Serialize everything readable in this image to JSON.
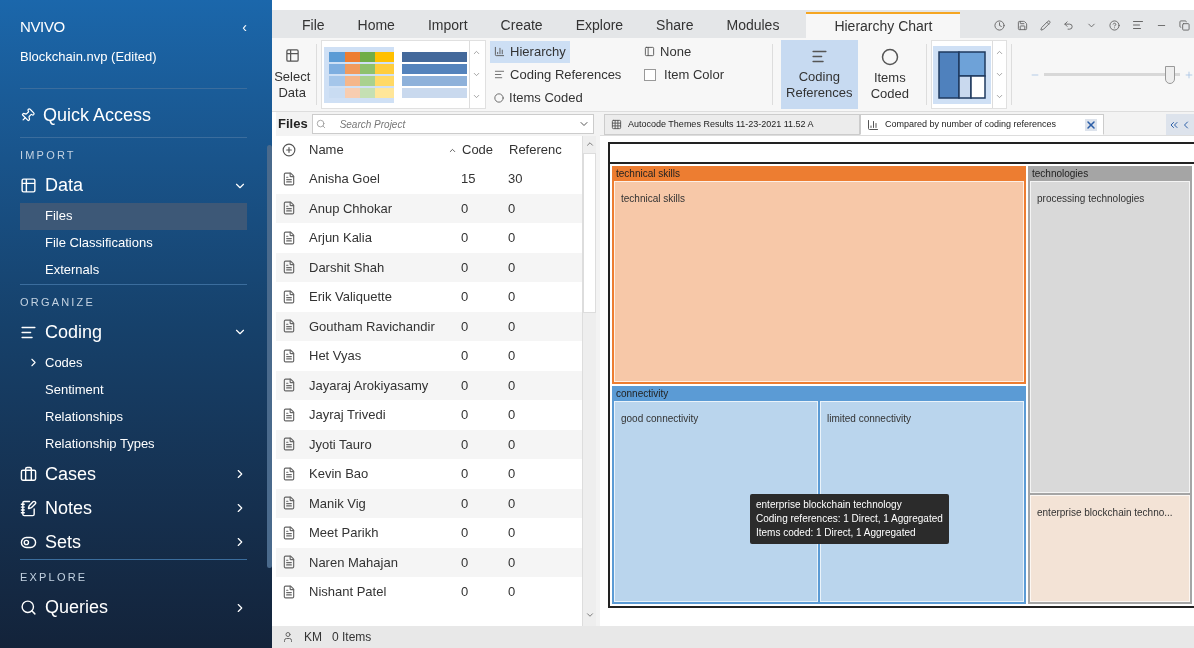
{
  "app": {
    "logo": "NVIVO",
    "project": "Blockchain.nvp (Edited)",
    "collapse": "‹"
  },
  "sidebar": {
    "quick_access": "Quick Access",
    "sections": [
      {
        "heading": "IMPORT",
        "items": [
          {
            "kind": "group",
            "label": "Data",
            "expanded": true,
            "selected": false
          },
          {
            "kind": "sub",
            "label": "Files",
            "selected": true
          },
          {
            "kind": "sub",
            "label": "File Classifications",
            "selected": false
          },
          {
            "kind": "sub",
            "label": "Externals",
            "selected": false
          }
        ]
      },
      {
        "heading": "ORGANIZE",
        "items": [
          {
            "kind": "group",
            "label": "Coding",
            "expanded": true,
            "selected": false
          },
          {
            "kind": "subtree",
            "label": "Codes",
            "expanded": false,
            "selected": false
          },
          {
            "kind": "sub",
            "label": "Sentiment",
            "selected": false
          },
          {
            "kind": "sub",
            "label": "Relationships",
            "selected": false
          },
          {
            "kind": "sub",
            "label": "Relationship Types",
            "selected": false
          },
          {
            "kind": "group",
            "label": "Cases",
            "expanded": false,
            "selected": false
          },
          {
            "kind": "group",
            "label": "Notes",
            "expanded": false,
            "selected": false
          },
          {
            "kind": "group",
            "label": "Sets",
            "expanded": false,
            "selected": false
          }
        ]
      },
      {
        "heading": "EXPLORE",
        "items": [
          {
            "kind": "group",
            "label": "Queries",
            "expanded": false,
            "selected": false
          }
        ]
      }
    ]
  },
  "ribbon_tabs": [
    {
      "label": "File",
      "selected": false
    },
    {
      "label": "Home",
      "selected": false
    },
    {
      "label": "Import",
      "selected": false
    },
    {
      "label": "Create",
      "selected": false
    },
    {
      "label": "Explore",
      "selected": false
    },
    {
      "label": "Share",
      "selected": false
    },
    {
      "label": "Modules",
      "selected": false
    },
    {
      "label": "Hierarchy Chart",
      "selected": true
    }
  ],
  "ribbon": {
    "select_data": "Select Data",
    "options": [
      {
        "kind": "hierarchy",
        "label": "Hierarchy",
        "selected": true
      },
      {
        "kind": "none",
        "label": "None",
        "selected": false
      },
      {
        "kind": "lines",
        "label": "Coding References",
        "selected": false
      },
      {
        "kind": "checkbox",
        "label": "Item Color",
        "checked": false
      },
      {
        "kind": "circle",
        "label": "Items Coded",
        "selected": false
      }
    ],
    "buttons": [
      {
        "kind": "lines",
        "label": "Coding References",
        "selected": true
      },
      {
        "kind": "circle",
        "label": "Items Coded",
        "selected": false
      }
    ],
    "slider": {
      "level": 0.93
    }
  },
  "files": {
    "title": "Files",
    "search": {
      "placeholder": "Search Project"
    },
    "columns": [
      {
        "label": "Name",
        "sorted": true
      },
      {
        "label": "Code",
        "sorted": false
      },
      {
        "label": "Referenc",
        "sorted": false
      }
    ],
    "rows": [
      [
        "Anisha Goel",
        "15",
        "30"
      ],
      [
        "Anup Chhokar",
        "0",
        "0"
      ],
      [
        "Arjun Kalia",
        "0",
        "0"
      ],
      [
        "Darshit Shah",
        "0",
        "0"
      ],
      [
        "Erik Valiquette",
        "0",
        "0"
      ],
      [
        "Goutham Ravichandir",
        "0",
        "0"
      ],
      [
        "Het Vyas",
        "0",
        "0"
      ],
      [
        "Jayaraj Arokiyasamy",
        "0",
        "0"
      ],
      [
        "Jayraj Trivedi",
        "0",
        "0"
      ],
      [
        "Jyoti Tauro",
        "0",
        "0"
      ],
      [
        "Kevin Bao",
        "0",
        "0"
      ],
      [
        "Manik Vig",
        "0",
        "0"
      ],
      [
        "Meet Parikh",
        "0",
        "0"
      ],
      [
        "Naren Mahajan",
        "0",
        "0"
      ],
      [
        "Nishant Patel",
        "0",
        "0"
      ]
    ]
  },
  "doc_tabs": [
    {
      "label": "Autocode Themes Results 11-23-2021 11.52 A",
      "kind": "table",
      "selected": false
    },
    {
      "label": "Compared by number of coding references",
      "kind": "chart",
      "selected": true
    }
  ],
  "treemap": {
    "nodes": [
      {
        "label": "technical skills",
        "color": "#ed7d31",
        "children": [
          {
            "label": "technical skills",
            "highlighted": false
          }
        ]
      },
      {
        "label": "connectivity",
        "color": "#5b9bd5",
        "children": [
          {
            "label": "good connectivity",
            "highlighted": false
          },
          {
            "label": "limited connectivity",
            "highlighted": false
          }
        ]
      },
      {
        "label": "technologies",
        "color": "#a5a5a5",
        "children": [
          {
            "label": "processing technologies",
            "highlighted": false
          },
          {
            "label": "enterprise blockchain techno...",
            "highlighted": true
          }
        ]
      }
    ],
    "tooltip": [
      "enterprise blockchain technology",
      "Coding references: 1 Direct, 1 Aggregated",
      "Items coded: 1 Direct, 1 Aggregated"
    ]
  },
  "status_bar": {
    "user": "KM",
    "items": "0 Items"
  }
}
